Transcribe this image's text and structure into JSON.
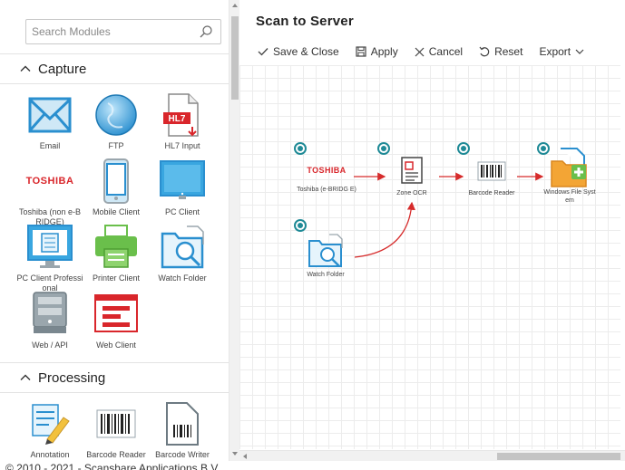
{
  "search": {
    "placeholder": "Search Modules"
  },
  "sections": {
    "capture": {
      "title": "Capture"
    },
    "processing": {
      "title": "Processing"
    }
  },
  "capture_modules": [
    {
      "label": "Email",
      "icon": "email-icon"
    },
    {
      "label": "FTP",
      "icon": "ftp-icon"
    },
    {
      "label": "HL7 Input",
      "icon": "hl7-icon",
      "badge": "HL7"
    },
    {
      "label": "Toshiba (non e-B RIDGE)",
      "icon": "toshiba-logo",
      "logo_text": "TOSHIBA"
    },
    {
      "label": "Mobile Client",
      "icon": "mobile-icon"
    },
    {
      "label": "PC Client",
      "icon": "monitor-icon"
    },
    {
      "label": "PC Client Professi onal",
      "icon": "pc-pro-icon"
    },
    {
      "label": "Printer Client",
      "icon": "printer-icon"
    },
    {
      "label": "Watch Folder",
      "icon": "watch-folder-icon"
    },
    {
      "label": "Web / API",
      "icon": "server-icon"
    },
    {
      "label": "Web Client",
      "icon": "web-client-icon"
    }
  ],
  "processing_modules": [
    {
      "label": "Annotation",
      "icon": "annotation-icon"
    },
    {
      "label": "Barcode Reader",
      "icon": "barcode-icon"
    },
    {
      "label": "Barcode Writer",
      "icon": "barcode-writer-icon"
    }
  ],
  "footer": {
    "copyright": "© 2010 - 2021 - Scanshare Applications B.V."
  },
  "page": {
    "title": "Scan to Server"
  },
  "toolbar": {
    "save_close": "Save & Close",
    "apply": "Apply",
    "cancel": "Cancel",
    "reset": "Reset",
    "export": "Export"
  },
  "workflow_nodes": [
    {
      "label": "Toshiba (e-BRIDG E)",
      "icon": "toshiba-logo",
      "logo_text": "TOSHIBA"
    },
    {
      "label": "Zone OCR",
      "icon": "zone-ocr-icon"
    },
    {
      "label": "Barcode Reader",
      "icon": "barcode-icon"
    },
    {
      "label": "Windows File Syst em",
      "icon": "windows-file-system-icon"
    },
    {
      "label": "Watch Folder",
      "icon": "watch-folder-icon"
    }
  ],
  "colors": {
    "accent": "#1f8a96",
    "arrow": "#d62b2b",
    "icon_blue": "#2a8fcf",
    "icon_green": "#6abf4b",
    "icon_red": "#d9262b"
  }
}
